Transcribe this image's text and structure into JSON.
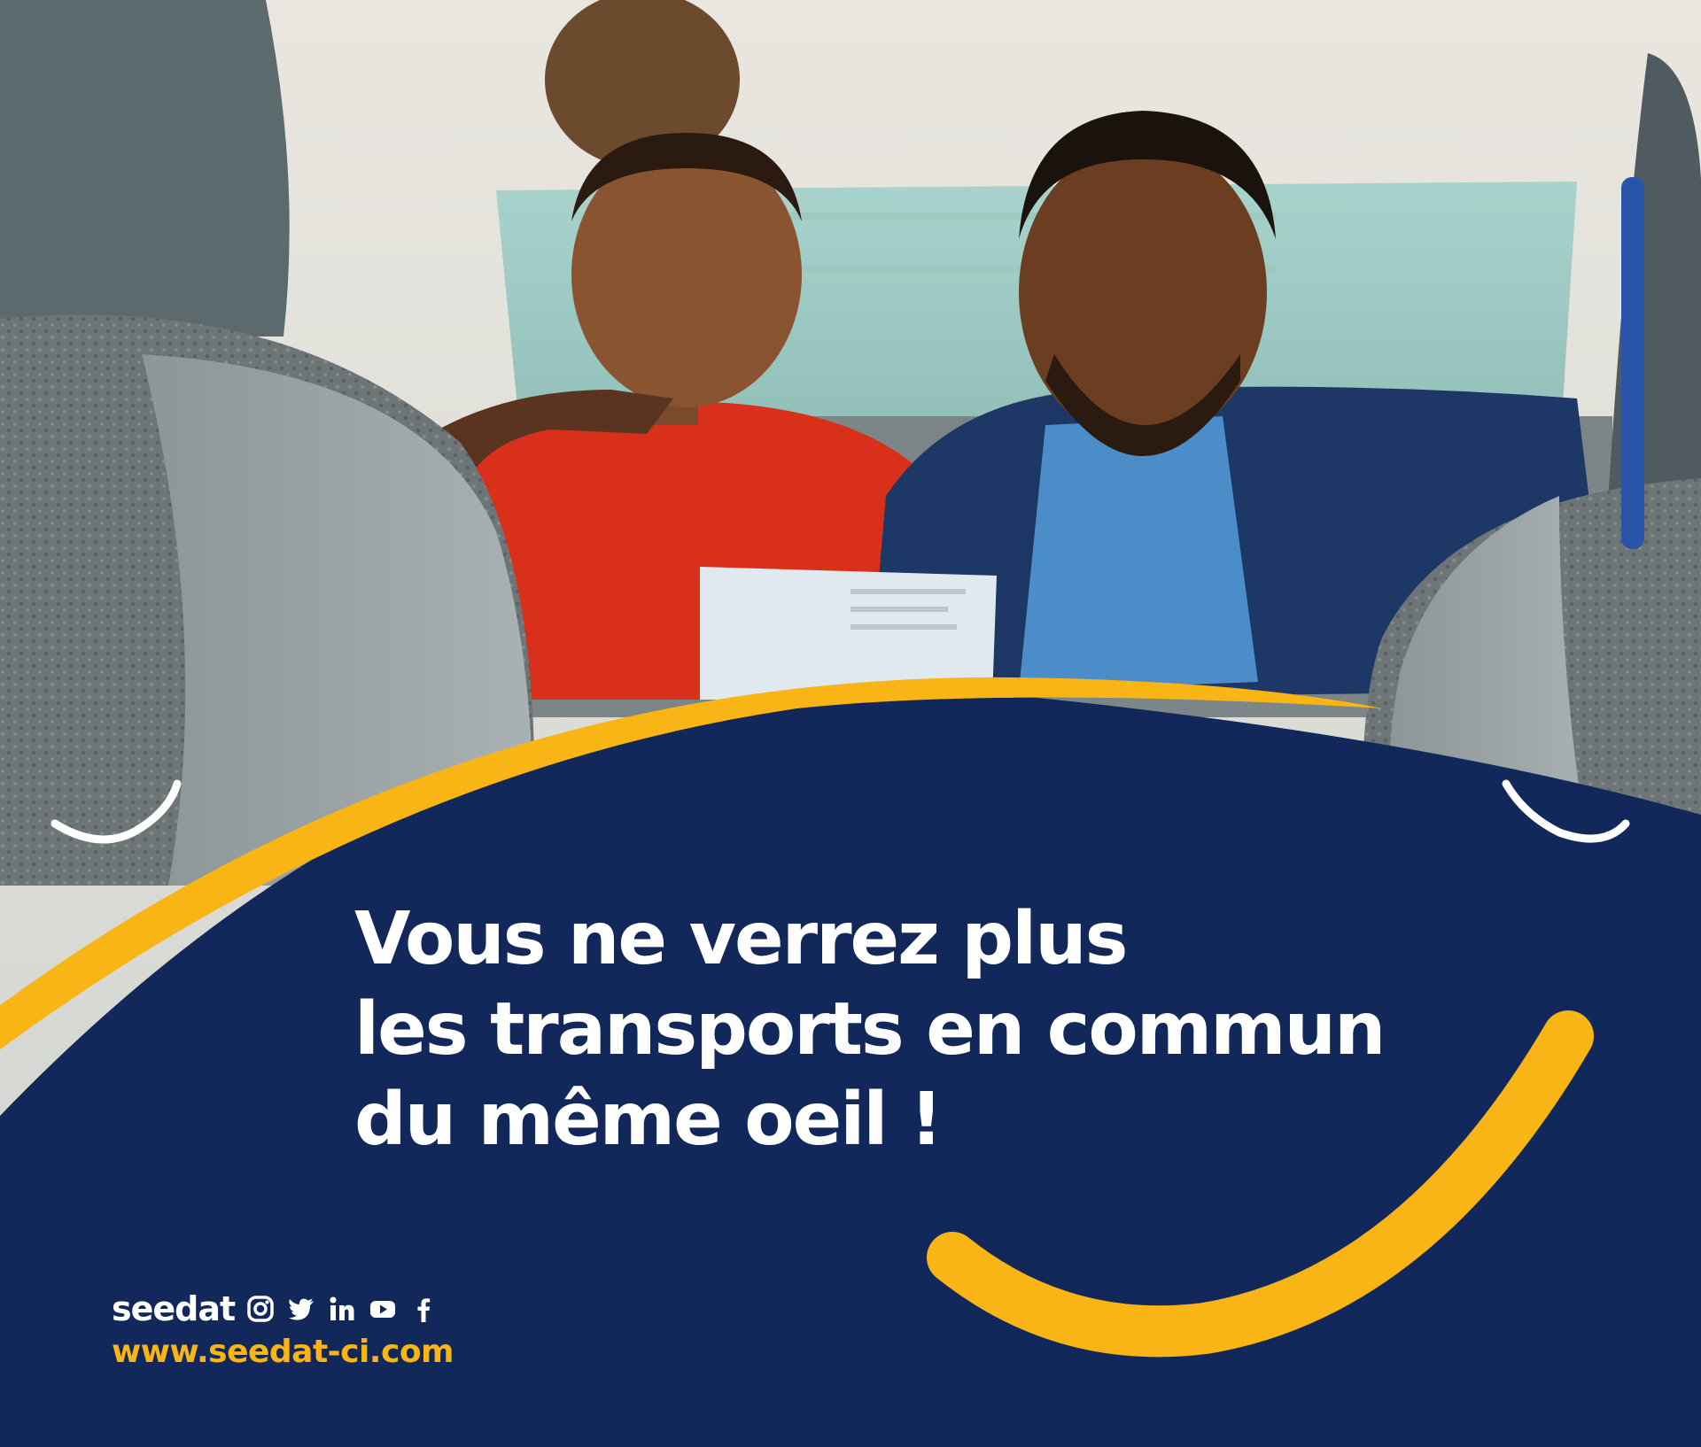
{
  "headline": {
    "line1": "Vous ne verrez plus",
    "line2": "les transports en commun",
    "line3": "du même oeil !"
  },
  "footer": {
    "brand": "seedat",
    "url": "www.seedat-ci.com",
    "social_icons": [
      "instagram-icon",
      "twitter-icon",
      "linkedin-icon",
      "youtube-icon",
      "facebook-icon"
    ]
  },
  "photo": {
    "description_icons": [
      "car-interior",
      "woman-red-shirt",
      "man-blue-suit",
      "leaflet"
    ]
  },
  "colors": {
    "navy": "#13285a",
    "yellow": "#f8b515",
    "white": "#ffffff"
  }
}
